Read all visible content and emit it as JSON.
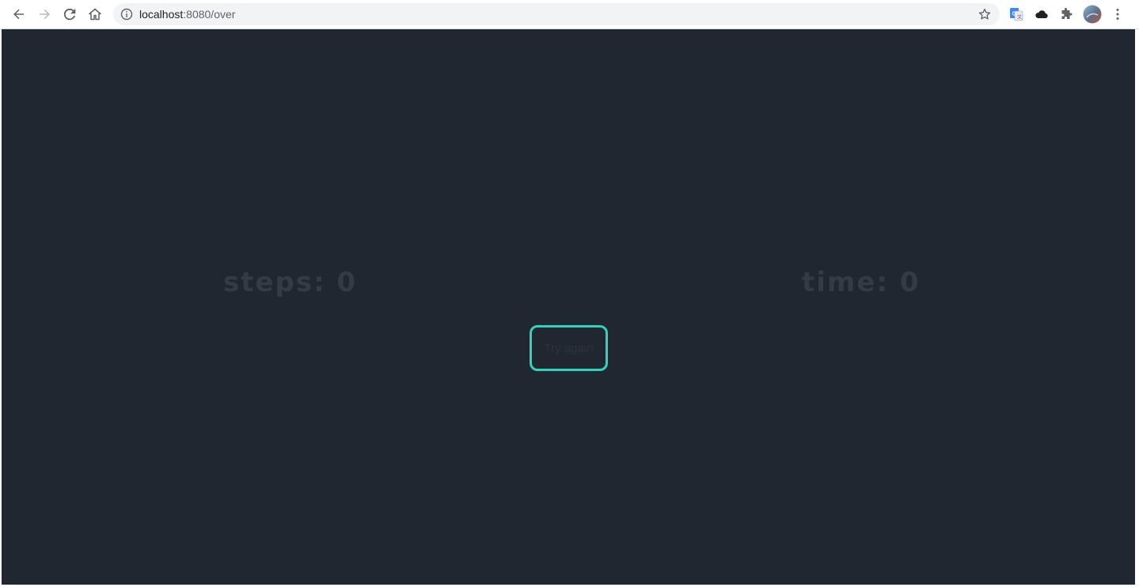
{
  "browser": {
    "url_host": "localhost",
    "url_rest": ":8080/over"
  },
  "game": {
    "steps_label": "steps: 0",
    "time_label": "time: 0",
    "try_again_label": "Try again"
  },
  "colors": {
    "background": "#212731",
    "accent": "#2dd4bf",
    "stat_text": "#343b46"
  }
}
